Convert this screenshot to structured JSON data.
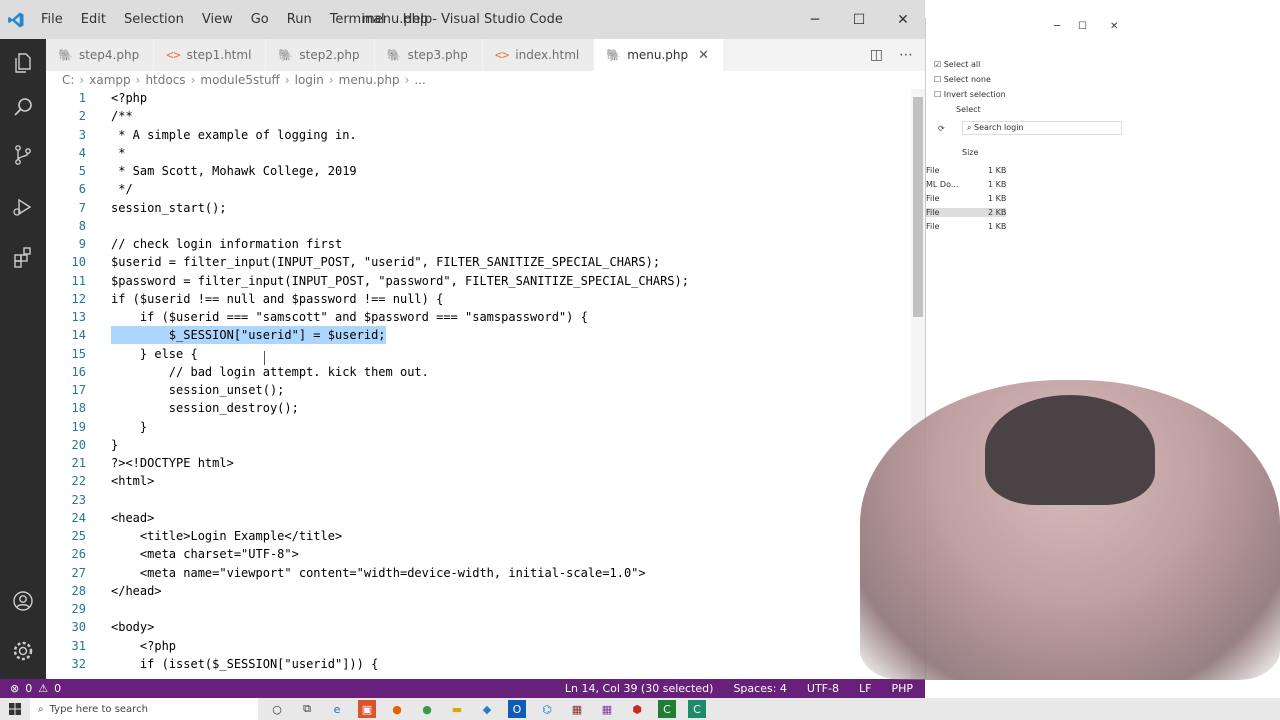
{
  "window": {
    "title": "menu.php - Visual Studio Code",
    "menu": [
      "File",
      "Edit",
      "Selection",
      "View",
      "Go",
      "Run",
      "Terminal",
      "Help"
    ]
  },
  "tabs": [
    {
      "label": "step4.php",
      "type": "php",
      "active": false
    },
    {
      "label": "step1.html",
      "type": "html",
      "active": false
    },
    {
      "label": "step2.php",
      "type": "php",
      "active": false
    },
    {
      "label": "step3.php",
      "type": "php",
      "active": false
    },
    {
      "label": "index.html",
      "type": "html",
      "active": false
    },
    {
      "label": "menu.php",
      "type": "php",
      "active": true
    }
  ],
  "breadcrumb": [
    "C:",
    "xampp",
    "htdocs",
    "module5stuff",
    "login",
    "menu.php",
    "..."
  ],
  "editor": {
    "lines": [
      {
        "n": "1",
        "text": "<?php"
      },
      {
        "n": "2",
        "text": "/**"
      },
      {
        "n": "3",
        "text": " * A simple example of logging in."
      },
      {
        "n": "4",
        "text": " *"
      },
      {
        "n": "5",
        "text": " * Sam Scott, Mohawk College, 2019"
      },
      {
        "n": "6",
        "text": " */"
      },
      {
        "n": "7",
        "text": "session_start();"
      },
      {
        "n": "8",
        "text": ""
      },
      {
        "n": "9",
        "text": "// check login information first"
      },
      {
        "n": "10",
        "text": "$userid = filter_input(INPUT_POST, \"userid\", FILTER_SANITIZE_SPECIAL_CHARS);"
      },
      {
        "n": "11",
        "text": "$password = filter_input(INPUT_POST, \"password\", FILTER_SANITIZE_SPECIAL_CHARS);"
      },
      {
        "n": "12",
        "text": "if ($userid !== null and $password !== null) {"
      },
      {
        "n": "13",
        "text": "    if ($userid === \"samscott\" and $password === \"samspassword\") {"
      },
      {
        "n": "14",
        "text": "        $_SESSION[\"userid\"] = $userid;",
        "selected": true
      },
      {
        "n": "15",
        "text": "    } else {"
      },
      {
        "n": "16",
        "text": "        // bad login attempt. kick them out."
      },
      {
        "n": "17",
        "text": "        session_unset();"
      },
      {
        "n": "18",
        "text": "        session_destroy();"
      },
      {
        "n": "19",
        "text": "    }"
      },
      {
        "n": "20",
        "text": "}"
      },
      {
        "n": "21",
        "text": "?><!DOCTYPE html>"
      },
      {
        "n": "22",
        "text": "<html>"
      },
      {
        "n": "23",
        "text": ""
      },
      {
        "n": "24",
        "text": "<head>"
      },
      {
        "n": "25",
        "text": "    <title>Login Example</title>"
      },
      {
        "n": "26",
        "text": "    <meta charset=\"UTF-8\">"
      },
      {
        "n": "27",
        "text": "    <meta name=\"viewport\" content=\"width=device-width, initial-scale=1.0\">"
      },
      {
        "n": "28",
        "text": "</head>"
      },
      {
        "n": "29",
        "text": ""
      },
      {
        "n": "30",
        "text": "<body>"
      },
      {
        "n": "31",
        "text": "    <?php"
      },
      {
        "n": "32",
        "text": "    if (isset($_SESSION[\"userid\"])) {"
      }
    ]
  },
  "status": {
    "errors": "0",
    "warnings": "0",
    "cursor": "Ln 14, Col 39 (30 selected)",
    "spaces": "Spaces: 4",
    "encoding": "UTF-8",
    "eol": "LF",
    "language": "PHP"
  },
  "explorer": {
    "select_all": "Select all",
    "select_none": "Select none",
    "invert_selection": "Invert selection",
    "select_group": "Select",
    "search_placeholder": "Search login",
    "size_header": "Size",
    "rows": [
      {
        "type": "File",
        "size": "1 KB"
      },
      {
        "type": "ML Do...",
        "size": "1 KB"
      },
      {
        "type": "File",
        "size": "1 KB"
      },
      {
        "type": "File",
        "size": "2 KB"
      },
      {
        "type": "File",
        "size": "1 KB"
      }
    ]
  },
  "taskbar": {
    "search_placeholder": "Type here to search"
  },
  "colors": {
    "status_bar": "#68217a",
    "activity_bar": "#2c2c2c",
    "selection": "#add6ff",
    "line_number": "#237893"
  }
}
